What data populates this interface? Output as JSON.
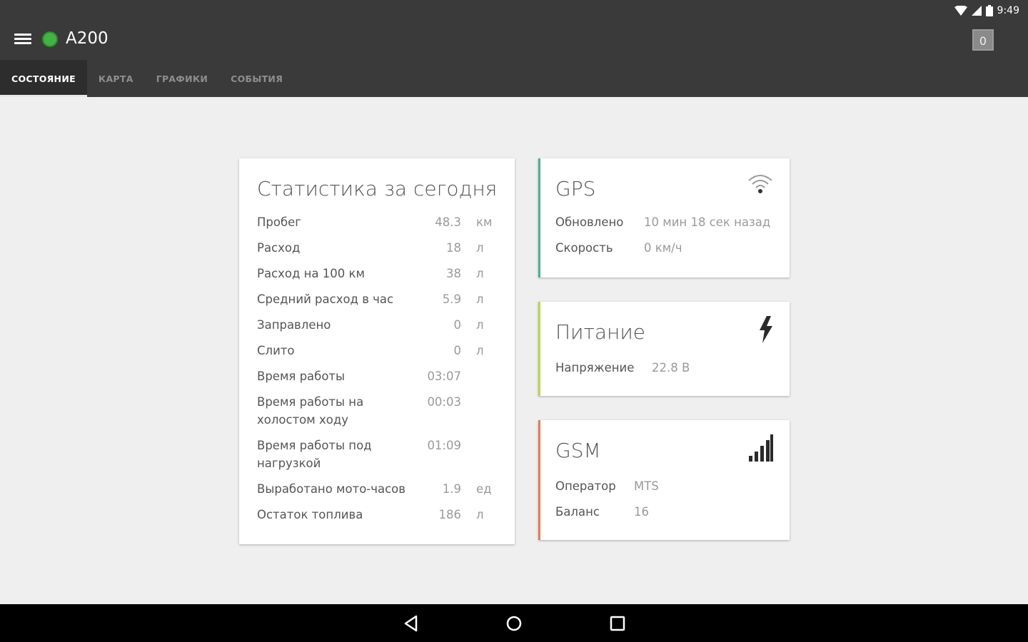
{
  "status_bar": {
    "time": "9:49"
  },
  "toolbar": {
    "title": "A200",
    "counter": "0"
  },
  "tabs": [
    {
      "label": "СОСТОЯНИЕ",
      "active": true
    },
    {
      "label": "КАРТА",
      "active": false
    },
    {
      "label": "ГРАФИКИ",
      "active": false
    },
    {
      "label": "СОБЫТИЯ",
      "active": false
    }
  ],
  "stats": {
    "title": "Статистика за сегодня",
    "rows": [
      {
        "label": "Пробег",
        "value": "48.3",
        "unit": "км"
      },
      {
        "label": "Расход",
        "value": "18",
        "unit": "л"
      },
      {
        "label": "Расход на 100 км",
        "value": "38",
        "unit": "л"
      },
      {
        "label": "Средний расход в час",
        "value": "5.9",
        "unit": "л"
      },
      {
        "label": "Заправлено",
        "value": "0",
        "unit": "л"
      },
      {
        "label": "Слито",
        "value": "0",
        "unit": "л"
      },
      {
        "label": "Время работы",
        "value": "03:07",
        "unit": ""
      },
      {
        "label": "Время работы на холостом ходу",
        "value": "00:03",
        "unit": ""
      },
      {
        "label": "Время работы под нагрузкой",
        "value": "01:09",
        "unit": ""
      },
      {
        "label": "Выработано мото-часов",
        "value": "1.9",
        "unit": "ед"
      },
      {
        "label": "Остаток топлива",
        "value": "186",
        "unit": "л"
      }
    ]
  },
  "gps": {
    "title": "GPS",
    "accent": "#4caf8f",
    "updated_label": "Обновлено",
    "updated_value": "10 мин 18 сек назад",
    "speed_label": "Скорость",
    "speed_value": "0 км/ч",
    "icon": "wifi-signal-icon"
  },
  "power": {
    "title": "Питание",
    "accent": "#b5d94a",
    "voltage_label": "Напряжение",
    "voltage_value": "22.8 В",
    "icon": "lightning-icon"
  },
  "gsm": {
    "title": "GSM",
    "accent": "#e87a5a",
    "operator_label": "Оператор",
    "operator_value": "MTS",
    "balance_label": "Баланс",
    "balance_value": "16",
    "icon": "cell-signal-icon"
  },
  "colors": {
    "appbar": "#3a3a3a",
    "status_ok": "#44b244",
    "background": "#efefef"
  }
}
